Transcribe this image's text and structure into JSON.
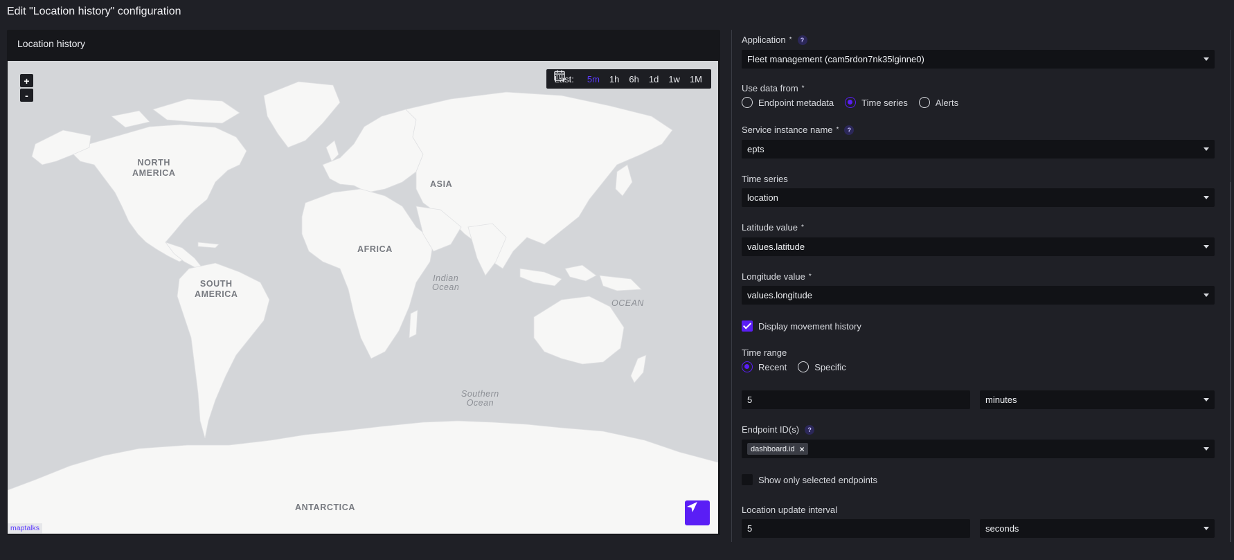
{
  "page": {
    "title": "Edit \"Location history\" configuration"
  },
  "preview": {
    "title": "Location history",
    "zoom_in": "+",
    "zoom_out": "-",
    "timebar": {
      "label": "Last:",
      "options": [
        "5m",
        "1h",
        "6h",
        "1d",
        "1w",
        "1M"
      ],
      "active": "5m"
    },
    "map_labels": {
      "north_america": "NORTH\nAMERICA",
      "south_america": "SOUTH\nAMERICA",
      "africa": "AFRICA",
      "asia": "ASIA",
      "antarctica": "ANTARCTICA",
      "indian_ocean": "Indian\nOcean",
      "ocean": "OCEAN",
      "southern_ocean": "Southern\nOcean"
    },
    "attribution": "maptalks",
    "accent_color": "#5a1ef5"
  },
  "form": {
    "application": {
      "label": "Application",
      "value": "Fleet management (cam5rdon7nk35lginne0)"
    },
    "use_data_from": {
      "label": "Use data from",
      "options": [
        "Endpoint metadata",
        "Time series",
        "Alerts"
      ],
      "selected": "Time series"
    },
    "service_instance": {
      "label": "Service instance name",
      "value": "epts"
    },
    "time_series": {
      "label": "Time series",
      "value": "location"
    },
    "latitude": {
      "label": "Latitude value",
      "value": "values.latitude"
    },
    "longitude": {
      "label": "Longitude value",
      "value": "values.longitude"
    },
    "display_history": {
      "label": "Display movement history",
      "checked": true
    },
    "time_range": {
      "label": "Time range",
      "options": [
        "Recent",
        "Specific"
      ],
      "selected": "Recent",
      "amount": "5",
      "unit": "minutes"
    },
    "endpoint_ids": {
      "label": "Endpoint ID(s)",
      "chips": [
        "dashboard.id"
      ],
      "remove": "×"
    },
    "show_selected": {
      "label": "Show only selected endpoints",
      "checked": false
    },
    "update_interval": {
      "label": "Location update interval",
      "amount": "5",
      "unit": "seconds"
    },
    "required_mark": "*",
    "help_mark": "?"
  }
}
